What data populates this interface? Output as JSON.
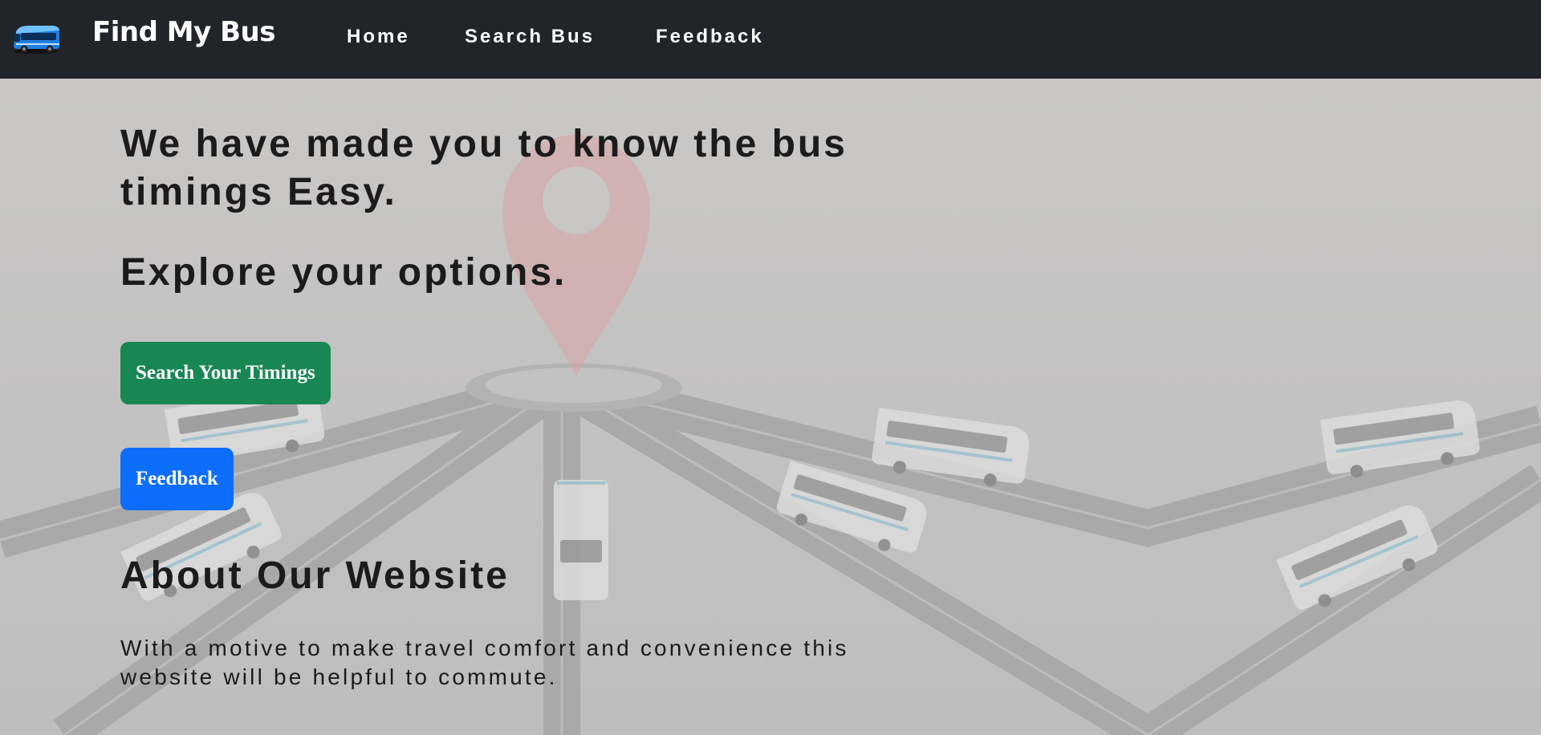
{
  "navbar": {
    "brand": "Find My Bus",
    "links": [
      "Home",
      "Search Bus",
      "Feedback"
    ]
  },
  "hero": {
    "headline": "We have made you to know the bus timings Easy.",
    "subheadline": "Explore your options."
  },
  "buttons": {
    "search_timings": "Search Your Timings",
    "feedback": "Feedback"
  },
  "about": {
    "title": "About Our Website",
    "text": "With a motive to make travel comfort and convenience this website will be helpful to commute."
  },
  "colors": {
    "navbar_bg": "#212429",
    "search_button": "#198754",
    "feedback_button": "#0d6efd",
    "text": "#1c1b1b"
  },
  "icons": {
    "brand": "bus-icon",
    "background_pin": "location-pin-icon"
  }
}
